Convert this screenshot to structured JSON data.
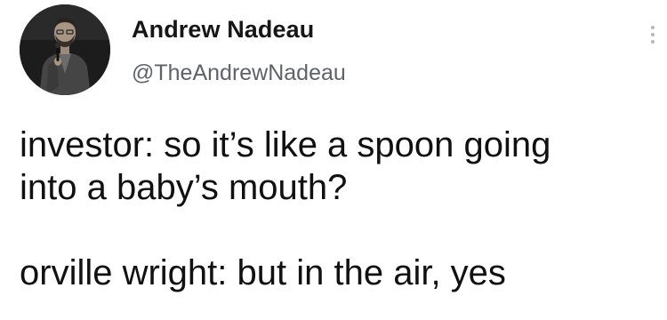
{
  "author": {
    "display_name": "Andrew Nadeau",
    "handle": "@TheAndrewNadeau",
    "avatar_icon": "profile-photo"
  },
  "menu": {
    "icon": "more-options-icon"
  },
  "tweet": {
    "text": "investor: so it’s like a spoon going\ninto a baby’s mouth?\n\norville wright: but in the air, yes"
  }
}
